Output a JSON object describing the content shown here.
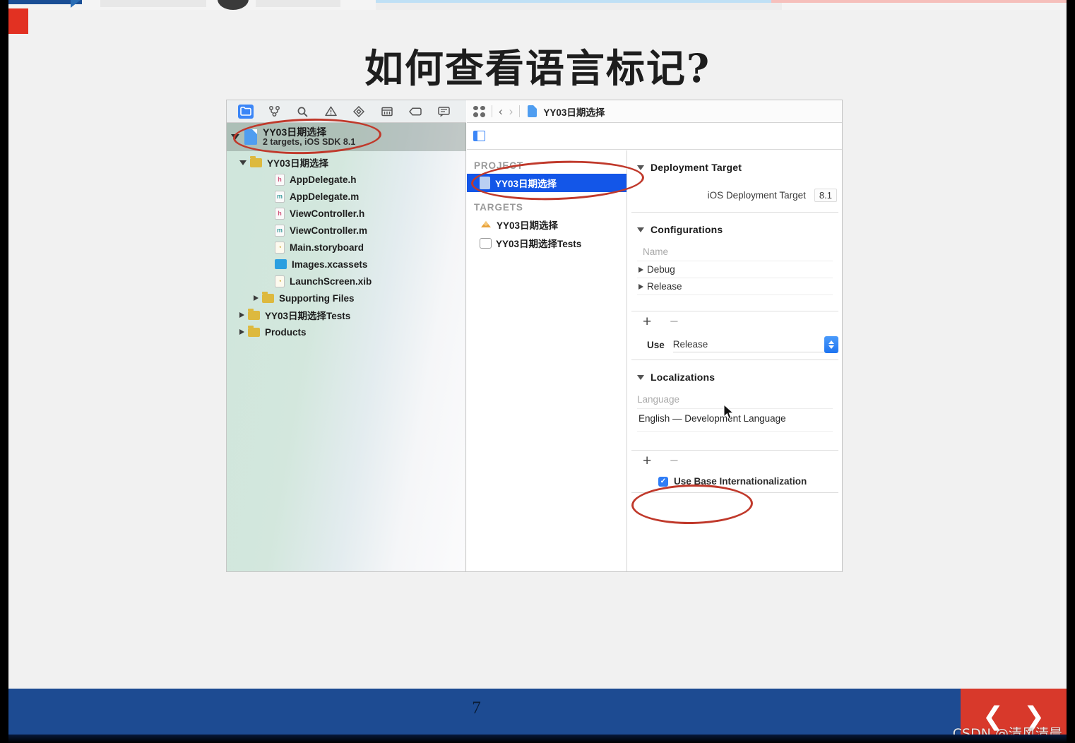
{
  "slide": {
    "title": "如何查看语言标记?",
    "page_number": "7",
    "watermark": "CSDN @清风清晨"
  },
  "xcode": {
    "navigator_toolbar": [
      {
        "name": "project-navigator-icon",
        "label": "folder",
        "selected": true
      },
      {
        "name": "source-control-navigator-icon",
        "label": "source-control",
        "selected": false
      },
      {
        "name": "symbol-navigator-icon",
        "label": "search",
        "selected": false
      },
      {
        "name": "issue-navigator-icon",
        "label": "warning",
        "selected": false
      },
      {
        "name": "test-navigator-icon",
        "label": "diamond",
        "selected": false
      },
      {
        "name": "debug-navigator-icon",
        "label": "debug",
        "selected": false
      },
      {
        "name": "breakpoint-navigator-icon",
        "label": "tag",
        "selected": false
      },
      {
        "name": "report-navigator-icon",
        "label": "report",
        "selected": false
      }
    ],
    "project_row": {
      "name": "YY03日期选择",
      "subtitle": "2 targets, iOS SDK 8.1"
    },
    "tree": [
      {
        "label": "YY03日期选择",
        "icon": "folder",
        "indent": 1,
        "twisty": "open"
      },
      {
        "label": "AppDelegate.h",
        "icon": "h",
        "indent": 3,
        "twisty": "none"
      },
      {
        "label": "AppDelegate.m",
        "icon": "m",
        "indent": 3,
        "twisty": "none"
      },
      {
        "label": "ViewController.h",
        "icon": "h",
        "indent": 3,
        "twisty": "none"
      },
      {
        "label": "ViewController.m",
        "icon": "m",
        "indent": 3,
        "twisty": "none"
      },
      {
        "label": "Main.storyboard",
        "icon": "sb",
        "indent": 3,
        "twisty": "none"
      },
      {
        "label": "Images.xcassets",
        "icon": "assets",
        "indent": 3,
        "twisty": "none"
      },
      {
        "label": "LaunchScreen.xib",
        "icon": "xib",
        "indent": 3,
        "twisty": "none"
      },
      {
        "label": "Supporting Files",
        "icon": "folder",
        "indent": 2,
        "twisty": "closed"
      },
      {
        "label": "YY03日期选择Tests",
        "icon": "folder",
        "indent": 1,
        "twisty": "closed"
      },
      {
        "label": "Products",
        "icon": "folder",
        "indent": 1,
        "twisty": "closed"
      }
    ],
    "jumpbar": {
      "back_chevron": "‹",
      "forward_chevron": "›",
      "crumb_label": "YY03日期选择"
    },
    "project_targets_pane": {
      "project_header": "PROJECT",
      "project_item": "YY03日期选择",
      "targets_header": "TARGETS",
      "targets": [
        {
          "label": "YY03日期选择",
          "icon": "app"
        },
        {
          "label": "YY03日期选择Tests",
          "icon": "test-bundle"
        }
      ]
    },
    "settings": {
      "deployment_target": {
        "section_title": "Deployment Target",
        "field_label": "iOS Deployment Target",
        "field_value": "8.1"
      },
      "configurations": {
        "section_title": "Configurations",
        "column_header": "Name",
        "rows": [
          "Debug",
          "Release"
        ],
        "add_label": "+",
        "remove_label": "−",
        "use_label": "Use",
        "use_value": "Release"
      },
      "localizations": {
        "section_title": "Localizations",
        "column_header": "Language",
        "rows": [
          "English — Development Language"
        ],
        "add_label": "+",
        "remove_label": "−",
        "checkbox_label": "Use Base Internationalization",
        "checkbox_checked": true,
        "checkbox_glyph": "✓"
      }
    }
  },
  "colors": {
    "annotation_red": "#c0392b",
    "selection_blue": "#1356e8",
    "footer_blue": "#1d4b92",
    "nav_red": "#d8392b",
    "accent_blue": "#3b86f7"
  }
}
